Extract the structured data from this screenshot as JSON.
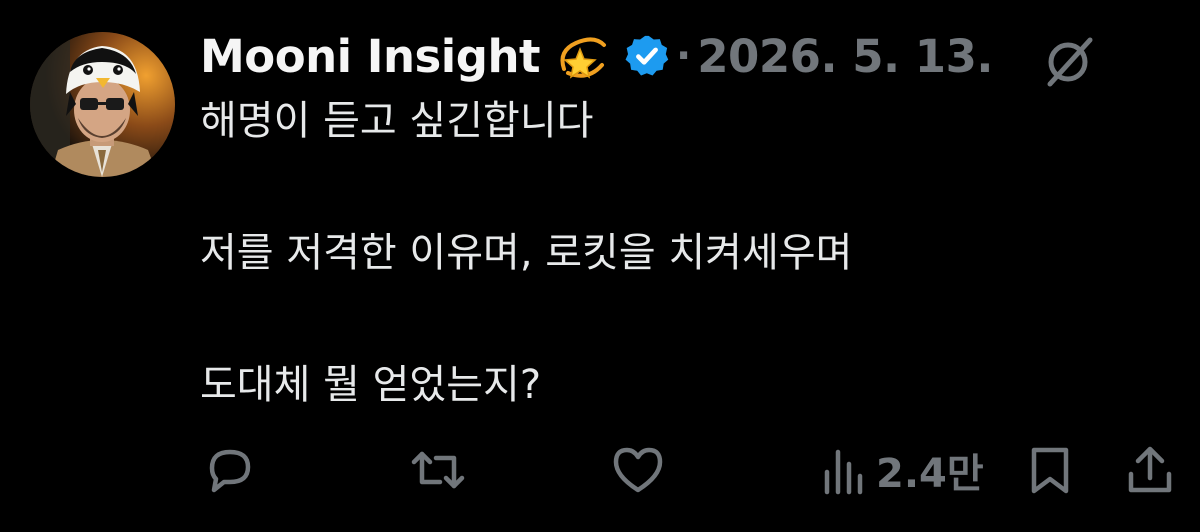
{
  "author": {
    "display_name": "Mooni Insight",
    "emoji": "dizzy-star-emoji",
    "verified_icon": "verified-badge-icon",
    "separator": "·",
    "timestamp": "2026. 5. 13."
  },
  "tweet": {
    "lines": [
      "해명이 듣고 싶긴합니다",
      "저를 저격한 이유며, 로킷을 치켜세우며",
      "도대체 뭘 얻었는지?"
    ]
  },
  "actions": {
    "reply_icon": "reply-icon",
    "retweet_icon": "retweet-icon",
    "like_icon": "like-icon",
    "views_icon": "views-icon",
    "views_count": "2.4만",
    "bookmark_icon": "bookmark-icon",
    "share_icon": "share-icon"
  },
  "colors": {
    "background": "#000000",
    "text": "#e7e9ea",
    "muted": "#71767b",
    "verified": "#1d9bf0"
  }
}
